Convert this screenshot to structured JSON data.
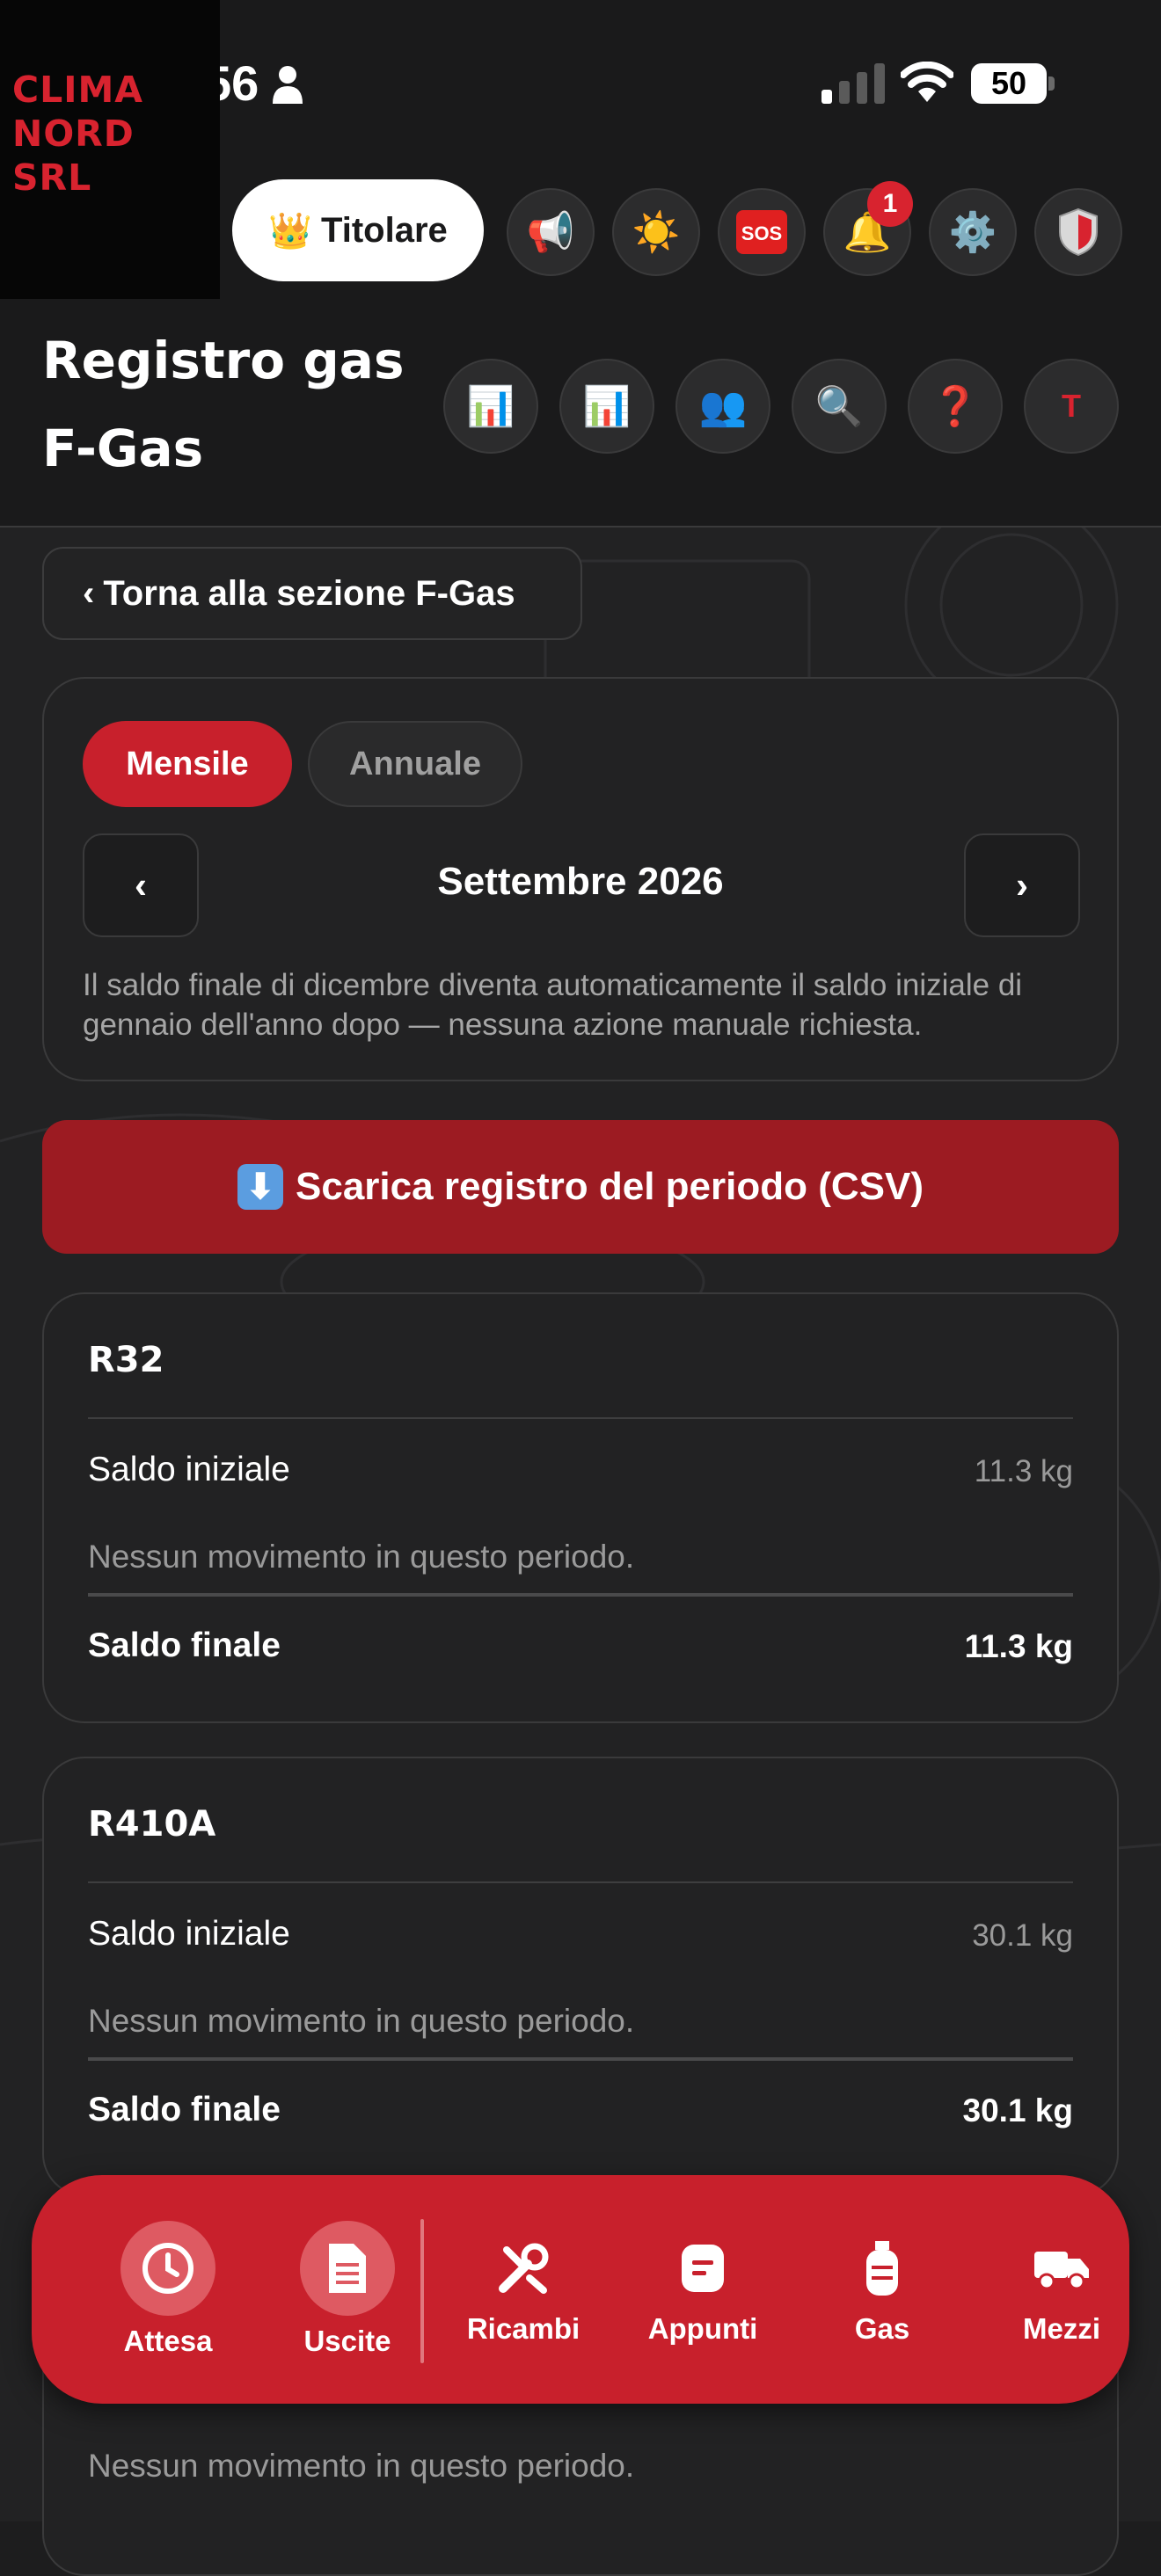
{
  "status_bar": {
    "time_partial": "56",
    "battery": "50"
  },
  "logo": {
    "line1": "CLIMA",
    "line2": "NORD",
    "line3": "SRL"
  },
  "header": {
    "role_label": "Titolare",
    "role_icon": "crown-icon",
    "notifications_count": "1",
    "sos_label": "SOS",
    "title_line1": "Registro gas",
    "title_line2": "F-Gas",
    "avatar_initial": "T"
  },
  "back_button": {
    "label": "Torna alla sezione F-Gas"
  },
  "period": {
    "tabs": [
      {
        "label": "Mensile",
        "active": true
      },
      {
        "label": "Annuale",
        "active": false
      }
    ],
    "current": "Settembre 2026",
    "note": "Il saldo finale di dicembre diventa automaticamente il saldo iniziale di gennaio dell'anno dopo — nessuna azione manuale richiesta."
  },
  "download_button": {
    "label": "Scarica registro del periodo (CSV)"
  },
  "gas_cards": [
    {
      "name": "R32",
      "initial_label": "Saldo iniziale",
      "initial_value": "11.3 kg",
      "empty_text": "Nessun movimento in questo periodo.",
      "final_label": "Saldo finale",
      "final_value": "11.3 kg"
    },
    {
      "name": "R410A",
      "initial_label": "Saldo iniziale",
      "initial_value": "30.1 kg",
      "empty_text": "Nessun movimento in questo periodo.",
      "final_label": "Saldo finale",
      "final_value": "30.1 kg"
    },
    {
      "empty_text": "Nessun movimento in questo periodo."
    }
  ],
  "bottom_nav": {
    "items": [
      {
        "label": "Attesa",
        "icon": "clock-icon"
      },
      {
        "label": "Uscite",
        "icon": "document-icon"
      },
      {
        "label": "Ricambi",
        "icon": "tools-icon"
      },
      {
        "label": "Appunti",
        "icon": "notes-icon"
      },
      {
        "label": "Gas",
        "icon": "gas-cylinder-icon"
      },
      {
        "label": "Mezzi",
        "icon": "truck-icon"
      }
    ]
  },
  "colors": {
    "accent": "#c8202c",
    "download": "#9c1b22",
    "background": "#1a1a1b"
  }
}
